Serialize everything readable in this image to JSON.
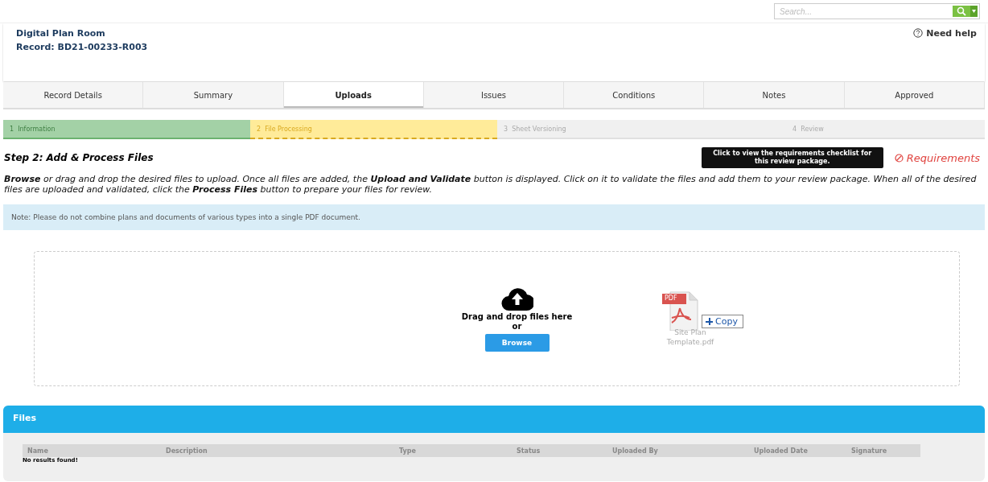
{
  "search": {
    "placeholder": "Search..."
  },
  "header": {
    "title": "Digital Plan Room",
    "record": "Record: BD21-00233-R003",
    "help": "Need help"
  },
  "tabs": [
    {
      "label": "Record Details",
      "selected": false
    },
    {
      "label": "Summary",
      "selected": false
    },
    {
      "label": "Uploads",
      "selected": true
    },
    {
      "label": "Issues",
      "selected": false
    },
    {
      "label": "Conditions",
      "selected": false
    },
    {
      "label": "Notes",
      "selected": false
    },
    {
      "label": "Approved",
      "selected": false
    }
  ],
  "steps": [
    {
      "number": "1",
      "label": "Information",
      "kind": "complete"
    },
    {
      "number": "2",
      "label": "File Processing",
      "kind": "current"
    },
    {
      "number": "3",
      "label": "Sheet Versioning",
      "kind": "upcoming"
    },
    {
      "number": "4",
      "label": "Review",
      "kind": "upcoming"
    }
  ],
  "step_heading": "Step 2: Add & Process Files",
  "tooltip": "Click to view the requirements checklist for this review package.",
  "requirements_link": "Requirements",
  "instructions": "**Browse** or drag and drop the desired files to upload. Once all files are added, the **Upload and Validate** button is displayed. Click on it to validate the files and add them to your review package. When all of the desired files are uploaded and validated, click the **Process Files** button to prepare your files for review.",
  "note": "Note: Please do not combine plans and documents of various types into a single PDF document.",
  "dropzone": {
    "prompt": "Drag and drop files here",
    "or": "or",
    "button": "Browse",
    "dragged_file": {
      "badge": "PDF",
      "name": "Site Plan Template.pdf",
      "action": "Copy"
    }
  },
  "files": {
    "title": "Files",
    "columns": [
      "Name",
      "Description",
      "Type",
      "Status",
      "Uploaded By",
      "Uploaded Date",
      "Signature"
    ],
    "empty": "No results found!"
  }
}
